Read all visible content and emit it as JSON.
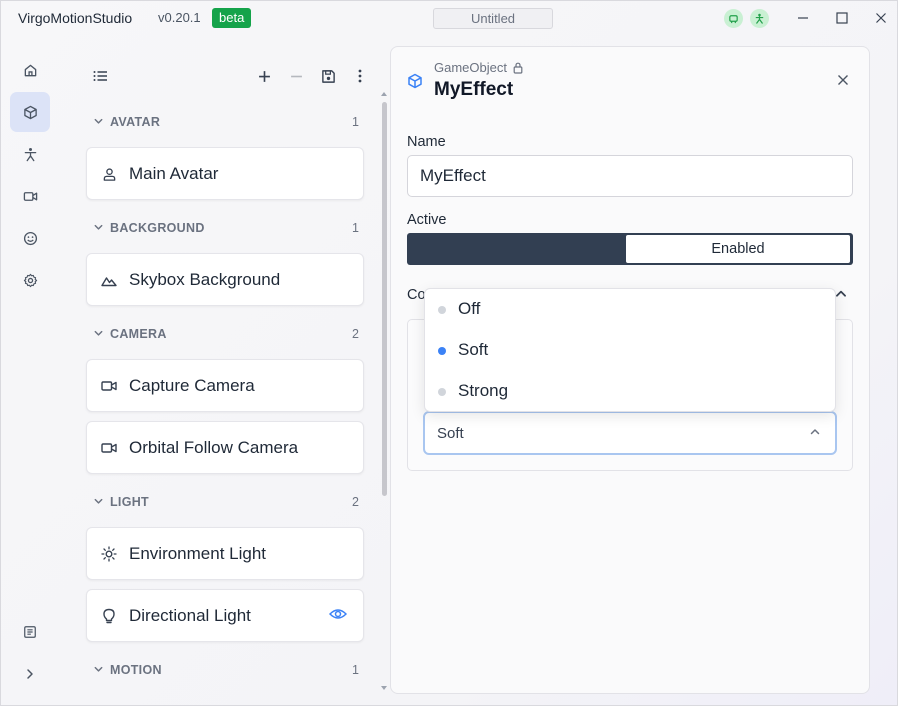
{
  "app": {
    "name": "VirgoMotionStudio",
    "version": "v0.20.1",
    "badge": "beta",
    "document_title": "Untitled"
  },
  "colors": {
    "accent": "#3b82f6",
    "badge": "#15a34a",
    "toggle_dark": "#323f52"
  },
  "rail": [
    {
      "icon": "home-icon"
    },
    {
      "icon": "cube-icon",
      "active": true
    },
    {
      "icon": "figure-icon"
    },
    {
      "icon": "camera-icon"
    },
    {
      "icon": "face-icon"
    },
    {
      "icon": "gear-icon"
    }
  ],
  "tree": {
    "sections": [
      {
        "label": "AVATAR",
        "count": "1",
        "items": [
          {
            "label": "Main Avatar",
            "icon": "person-icon"
          }
        ]
      },
      {
        "label": "BACKGROUND",
        "count": "1",
        "items": [
          {
            "label": "Skybox Background",
            "icon": "mountain-icon"
          }
        ]
      },
      {
        "label": "CAMERA",
        "count": "2",
        "items": [
          {
            "label": "Capture Camera",
            "icon": "camera-icon"
          },
          {
            "label": "Orbital Follow Camera",
            "icon": "camera-icon"
          }
        ]
      },
      {
        "label": "LIGHT",
        "count": "2",
        "items": [
          {
            "label": "Environment Light",
            "icon": "sun-icon"
          },
          {
            "label": "Directional Light",
            "icon": "bulb-icon"
          }
        ]
      },
      {
        "label": "MOTION",
        "count": "1",
        "items": []
      }
    ]
  },
  "inspector": {
    "type": "GameObject",
    "title": "MyEffect",
    "name_label": "Name",
    "name_value": "MyEffect",
    "active_label": "Active",
    "active_value": "Enabled",
    "section_truncated": "Co",
    "select_value": "Soft"
  },
  "dropdown": {
    "options": [
      {
        "label": "Off",
        "selected": false
      },
      {
        "label": "Soft",
        "selected": true
      },
      {
        "label": "Strong",
        "selected": false
      }
    ]
  }
}
